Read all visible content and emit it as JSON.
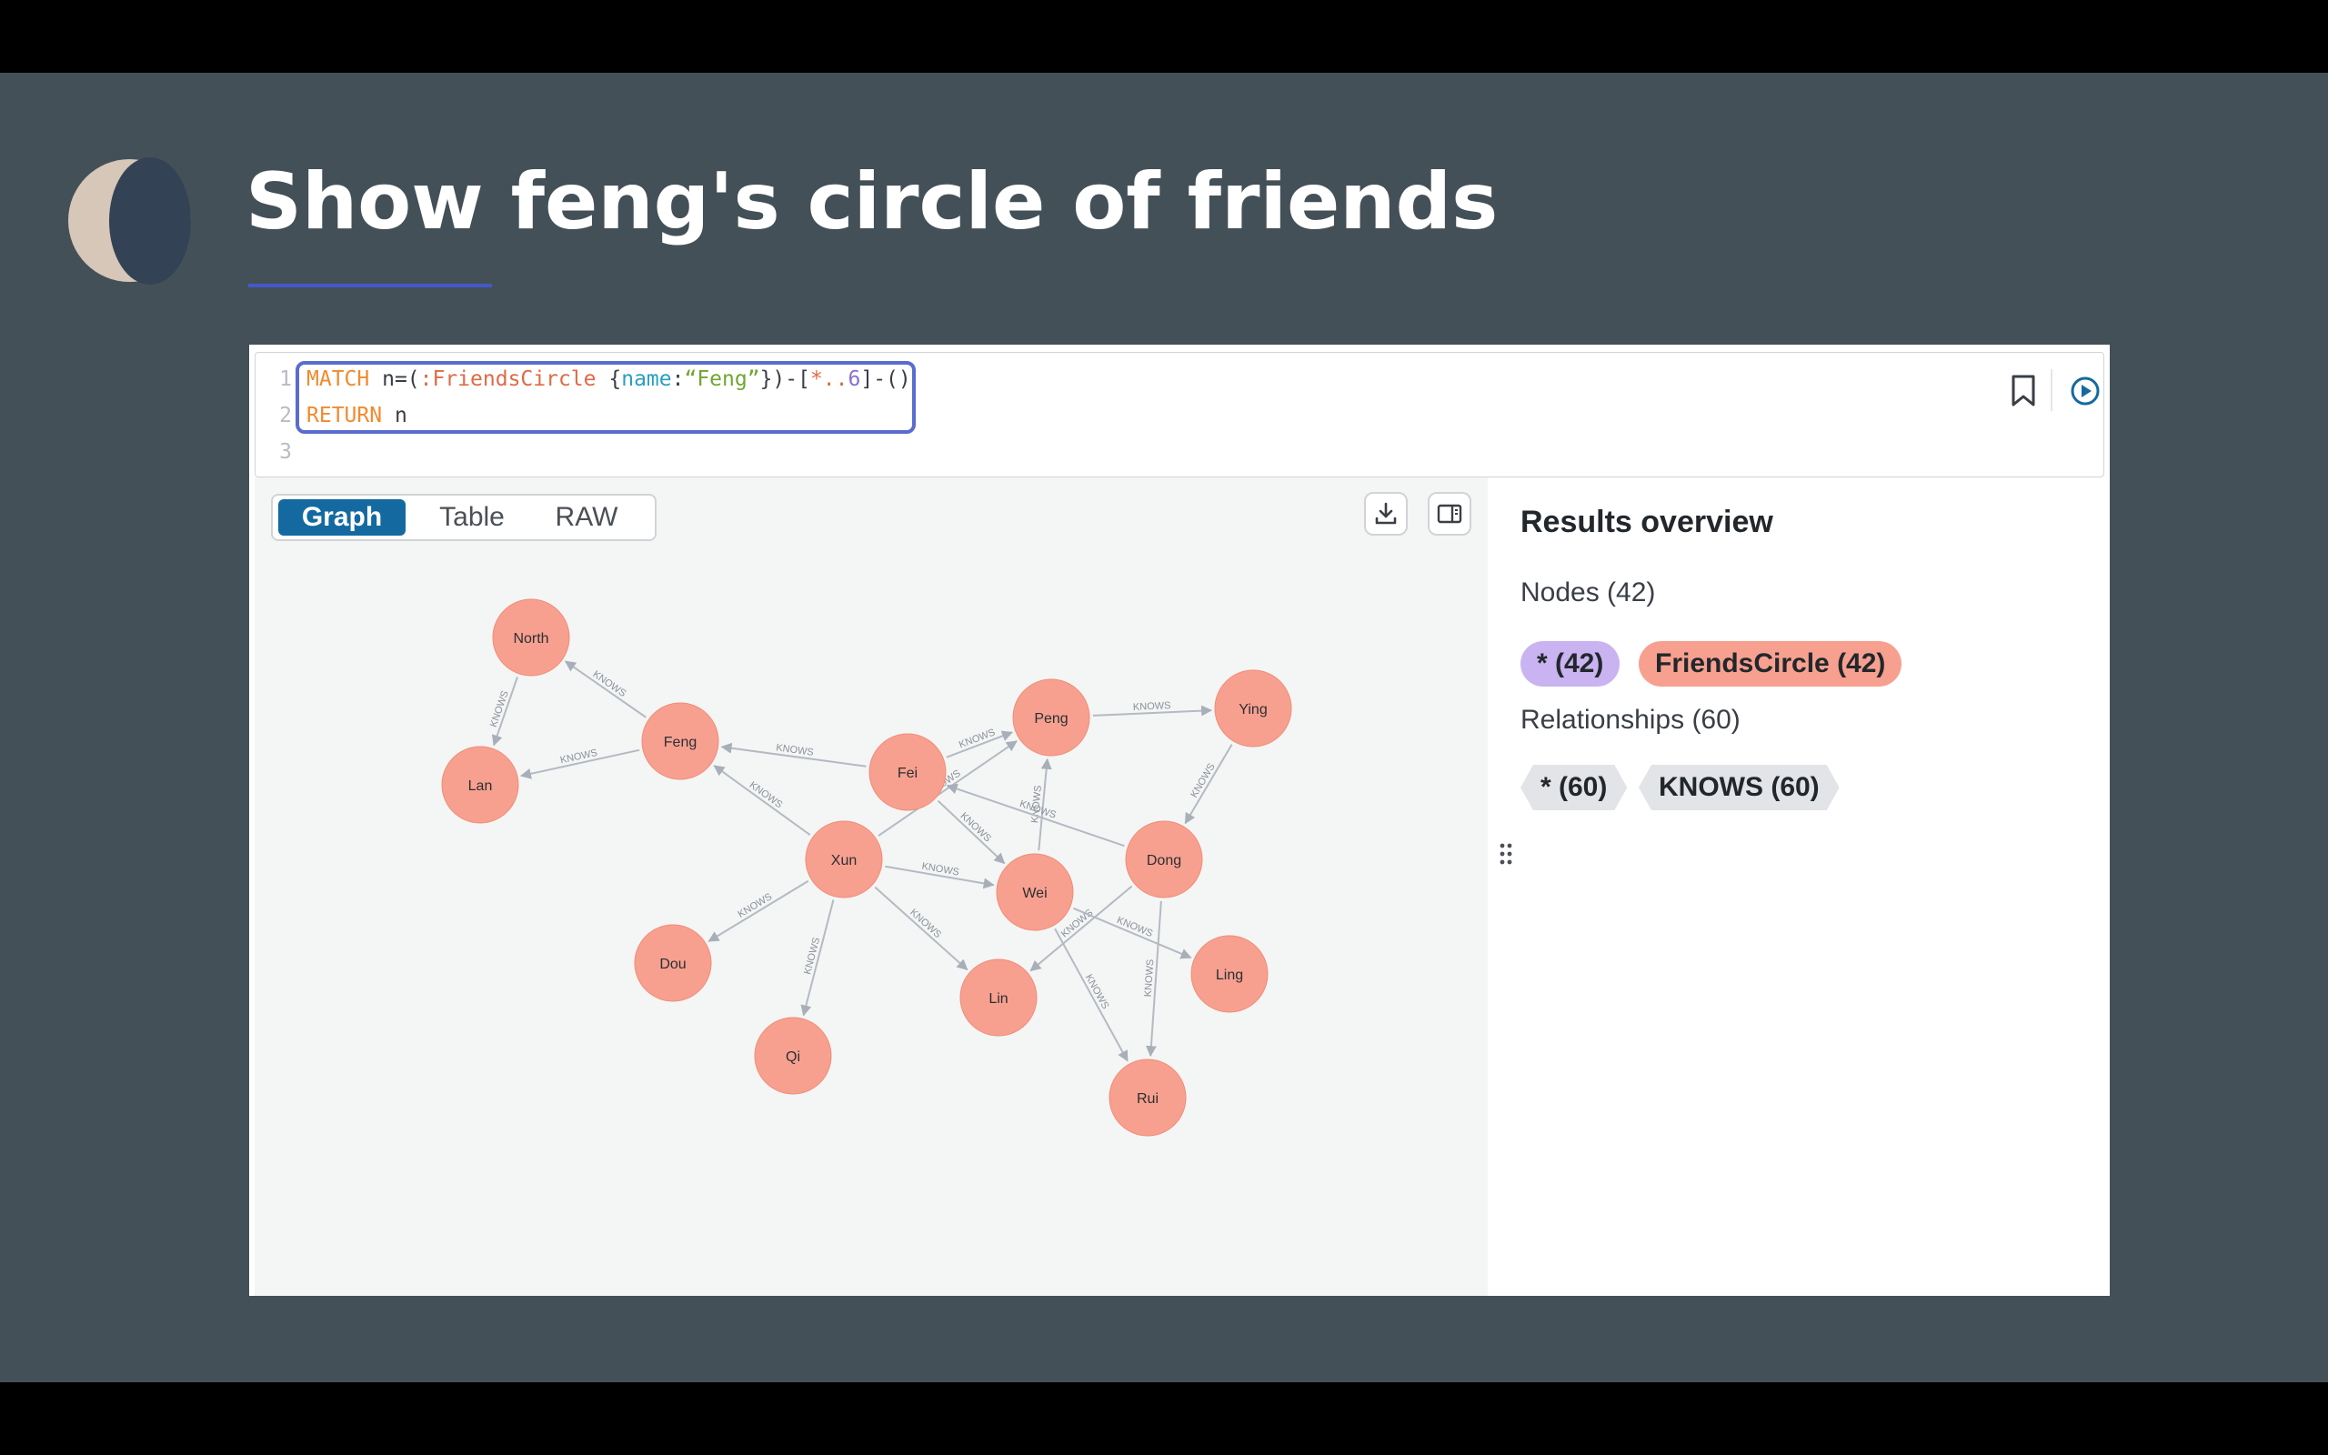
{
  "slide": {
    "title": "Show feng's circle of friends",
    "colors": {
      "background": "#445058",
      "accent": "#4458c8",
      "logo_light": "#d6c7b9",
      "logo_dark": "#344256"
    }
  },
  "editor": {
    "line_numbers": [
      "1",
      "2",
      "3"
    ],
    "line1": {
      "match": "MATCH",
      "n": " n=(",
      "label": ":FriendsCircle",
      "open": " {",
      "prop": "name",
      "colon": ":",
      "value": "“Feng”",
      "close": "})-[",
      "rel": "*..",
      "depth": "6",
      "tail": "]-()"
    },
    "line2": {
      "return": "RETURN",
      "n": " n"
    },
    "bookmark_icon": "bookmark-icon",
    "run_icon": "play-circle-icon"
  },
  "view_tabs": [
    "Graph",
    "Table",
    "RAW"
  ],
  "active_tab": "Graph",
  "toolbar": {
    "download_icon": "download-icon",
    "panel_icon": "side-panel-icon"
  },
  "graph": {
    "node_color": "#f7a08f",
    "edge_color": "#b4bac2",
    "edge_label": "KNOWS",
    "nodes": [
      "North",
      "Feng",
      "Lan",
      "Fei",
      "Peng",
      "Ying",
      "Xun",
      "Wei",
      "Dong",
      "Dou",
      "Qi",
      "Lin",
      "Ling",
      "Rui"
    ],
    "edges": [
      [
        "Feng",
        "North"
      ],
      [
        "North",
        "Lan"
      ],
      [
        "Feng",
        "Lan"
      ],
      [
        "Fei",
        "Feng"
      ],
      [
        "Xun",
        "Feng"
      ],
      [
        "Fei",
        "Peng"
      ],
      [
        "Peng",
        "Ying"
      ],
      [
        "Ying",
        "Dong"
      ],
      [
        "Xun",
        "Peng"
      ],
      [
        "Fei",
        "Wei"
      ],
      [
        "Wei",
        "Peng"
      ],
      [
        "Dong",
        "Fei"
      ],
      [
        "Xun",
        "Wei"
      ],
      [
        "Xun",
        "Dou"
      ],
      [
        "Xun",
        "Qi"
      ],
      [
        "Xun",
        "Lin"
      ],
      [
        "Dong",
        "Lin"
      ],
      [
        "Wei",
        "Ling"
      ],
      [
        "Wei",
        "Rui"
      ],
      [
        "Dong",
        "Rui"
      ]
    ]
  },
  "overview": {
    "title": "Results overview",
    "nodes_label": "Nodes (42)",
    "node_pills": [
      "* (42)",
      "FriendsCircle (42)"
    ],
    "relationships_label": "Relationships (60)",
    "rel_tags": [
      "* (60)",
      "KNOWS (60)"
    ],
    "colors": {
      "all_nodes": "#c9b3f0",
      "friends_circle": "#f7a08f",
      "rel_tag": "#e2e4e7"
    }
  }
}
